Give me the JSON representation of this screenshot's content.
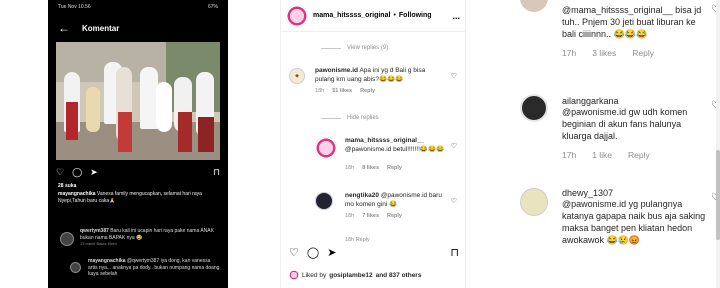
{
  "phone": {
    "status_left": "Tue Nov 10.56",
    "status_right": "67%",
    "title": "Komentar",
    "likes": "28 suka",
    "caption_user": "mayangnachika",
    "caption_text": "Vanesa family mengucapkan, selamat hari raya Nyepi,Tahun baru caka🙏",
    "comments": [
      {
        "user": "qwertym387",
        "text": "Baru kali ini ucapin hari raya pake nama ANAK bukan nama BAPAK nya 😂",
        "meta": "13 menit   Balas   Kirim"
      },
      {
        "user": "mayangnachika",
        "text": "@qwertym387 iya dong, kan vanessa artis nya... anaknya pa dody.. bukan numpang nama doang kaya sebelah",
        "meta": ""
      }
    ]
  },
  "post": {
    "username": "mama_hitssss_original",
    "follow_label": "Following",
    "more": "...",
    "view_replies_1": "View replies (9)",
    "hide_replies": "Hide replies",
    "comments": [
      {
        "user": "pawonisme.id",
        "text": "Apa ini yg d Bali g bisa pulang krn uang abis?😂😂😂",
        "time": "18h",
        "likes": "51 likes",
        "reply": "Reply"
      },
      {
        "user": "mama_hitssss_original__",
        "text": "@pawonisme.id betul!!!!!!!😂😂😂",
        "time": "18h",
        "likes": "8 likes",
        "reply": "Reply"
      },
      {
        "user": "nengtika20",
        "text": "@pawonisme.id baru mo komen gini 😂",
        "time": "18h",
        "likes": "7 likes",
        "reply": "Reply"
      }
    ],
    "partial_meta": "18h   Reply",
    "liked_by_prefix": "Liked by",
    "liked_by_user": "gosiplambe12",
    "liked_by_suffix": "and 837 others"
  },
  "right": {
    "comments": [
      {
        "user": "",
        "text": "@mama_hitssss_original__ bisa jd tuh.. Pnjem 30 jeti buat liburan ke bali ciiiinnn.. 😂😂😂",
        "time": "17h",
        "likes": "3 likes",
        "reply": "Reply"
      },
      {
        "user": "ailanggarkana",
        "text": "@pawonisme.id gw udh komen beginian di akun fans halunya kluarga dajjal.",
        "time": "17h",
        "likes": "1 like",
        "reply": "Reply"
      },
      {
        "user": "dhewy_1307",
        "text": "@pawonisme.id yg pulangnya katanya gapapa naik bus aja saking maksa banget pen kliatan hedon awokawok 😂😢😡",
        "time": "",
        "likes": "",
        "reply": ""
      }
    ]
  },
  "colors": {
    "accent_pink": "#e0327d",
    "meta_gray": "#8e8e8e",
    "text": "#262626"
  }
}
